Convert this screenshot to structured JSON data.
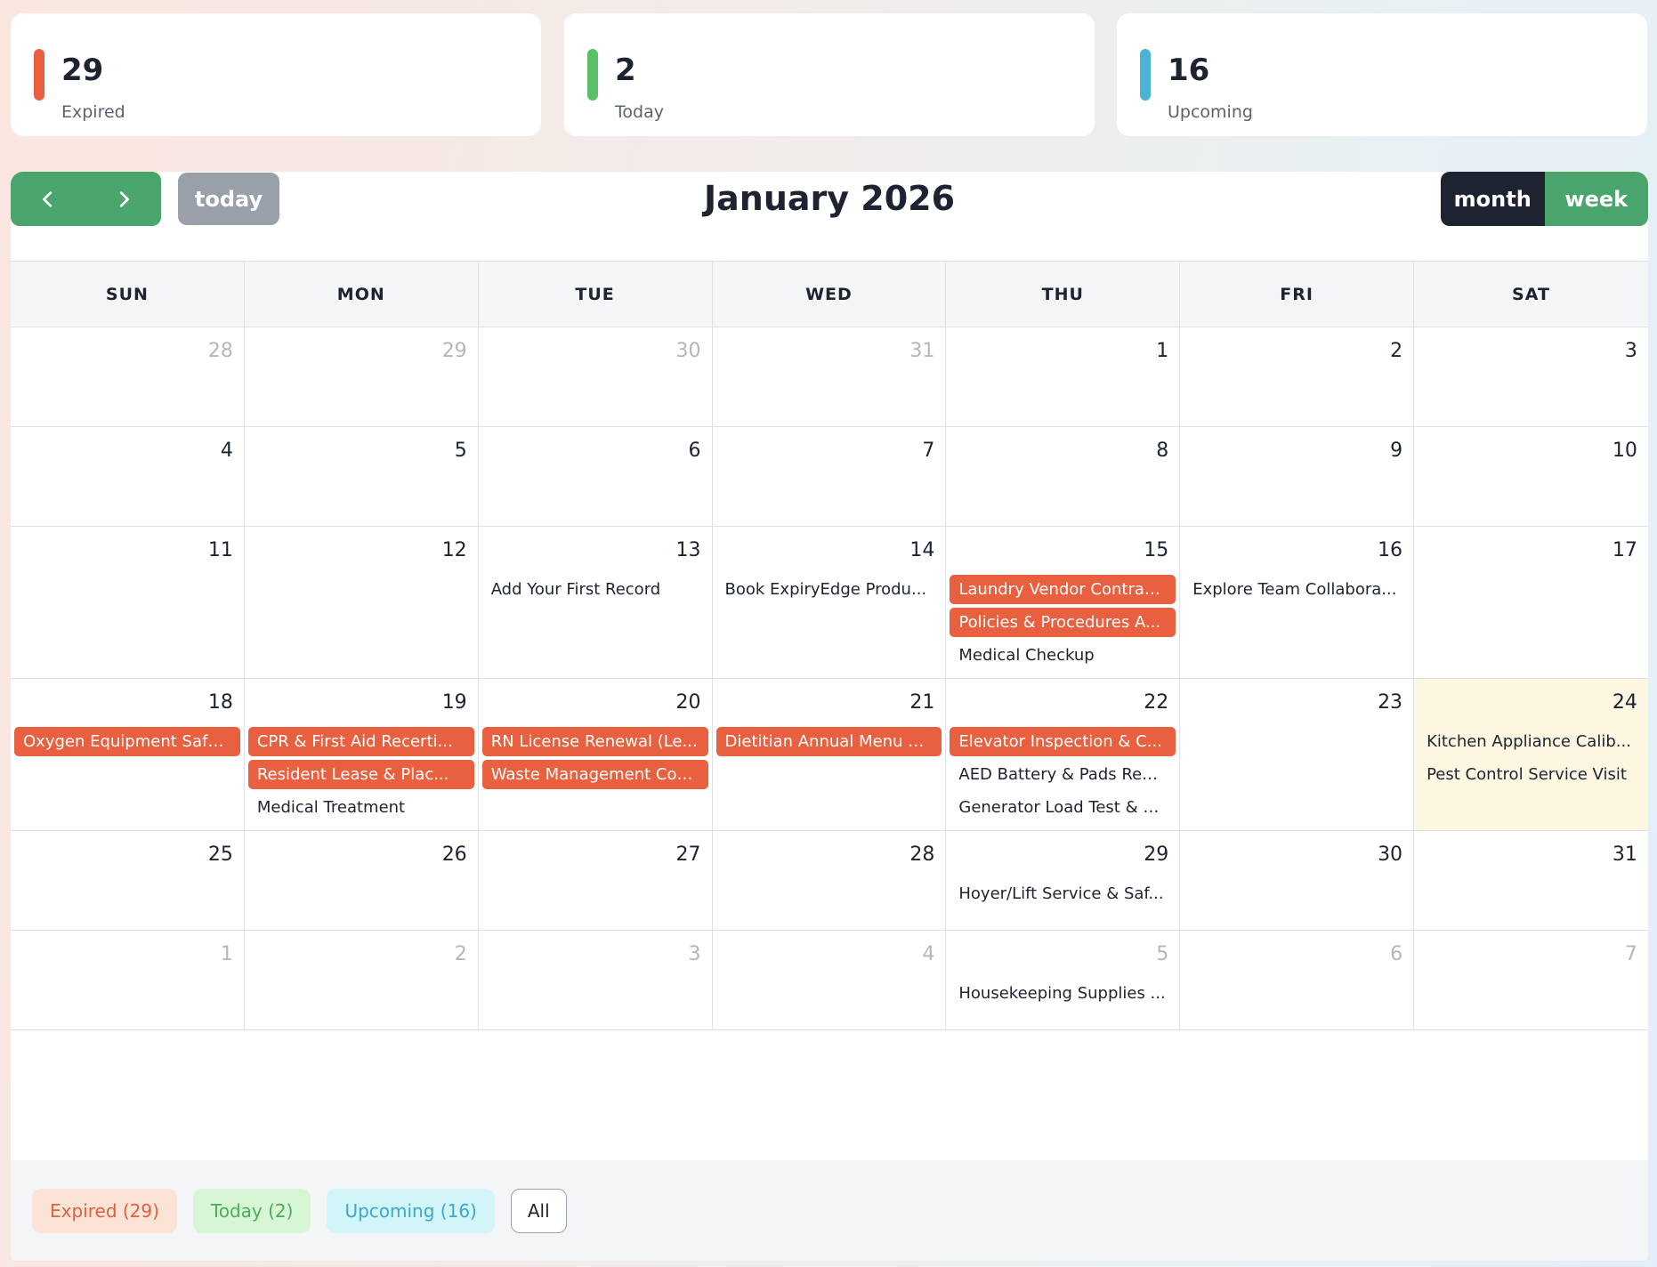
{
  "stats": [
    {
      "value": "29",
      "label": "Expired",
      "color": "#e8603f"
    },
    {
      "value": "2",
      "label": "Today",
      "color": "#59c068"
    },
    {
      "value": "16",
      "label": "Upcoming",
      "color": "#4bb3d6"
    }
  ],
  "toolbar": {
    "prev_icon": "chevron-left-icon",
    "next_icon": "chevron-right-icon",
    "today_label": "today",
    "title": "January 2026",
    "views": [
      {
        "label": "month",
        "active": true
      },
      {
        "label": "week",
        "active": false
      }
    ]
  },
  "weekdays": [
    "SUN",
    "MON",
    "TUE",
    "WED",
    "THU",
    "FRI",
    "SAT"
  ],
  "weeks": [
    {
      "height": 112,
      "days": [
        {
          "day": "28",
          "other": true,
          "events": []
        },
        {
          "day": "29",
          "other": true,
          "events": []
        },
        {
          "day": "30",
          "other": true,
          "events": []
        },
        {
          "day": "31",
          "other": true,
          "events": []
        },
        {
          "day": "1",
          "events": []
        },
        {
          "day": "2",
          "events": []
        },
        {
          "day": "3",
          "events": []
        }
      ]
    },
    {
      "height": 112,
      "days": [
        {
          "day": "4",
          "events": []
        },
        {
          "day": "5",
          "events": []
        },
        {
          "day": "6",
          "events": []
        },
        {
          "day": "7",
          "events": []
        },
        {
          "day": "8",
          "events": []
        },
        {
          "day": "9",
          "events": []
        },
        {
          "day": "10",
          "events": []
        }
      ]
    },
    {
      "height": 171,
      "days": [
        {
          "day": "11",
          "events": []
        },
        {
          "day": "12",
          "events": []
        },
        {
          "day": "13",
          "events": [
            {
              "title": "Add Your First Record",
              "status": "plain"
            }
          ]
        },
        {
          "day": "14",
          "events": [
            {
              "title": "Book ExpiryEdge Produ...",
              "status": "plain"
            }
          ]
        },
        {
          "day": "15",
          "events": [
            {
              "title": "Laundry Vendor Contrac...",
              "status": "expired"
            },
            {
              "title": "Policies & Procedures A...",
              "status": "expired"
            },
            {
              "title": "Medical Checkup",
              "status": "plain"
            }
          ]
        },
        {
          "day": "16",
          "events": [
            {
              "title": "Explore Team Collabora...",
              "status": "plain"
            }
          ]
        },
        {
          "day": "17",
          "events": []
        }
      ]
    },
    {
      "height": 171,
      "days": [
        {
          "day": "18",
          "events": [
            {
              "title": "Oxygen Equipment Safe...",
              "status": "expired"
            }
          ]
        },
        {
          "day": "19",
          "events": [
            {
              "title": "CPR & First Aid Recerti...",
              "status": "expired"
            },
            {
              "title": "Resident Lease &    Plac...",
              "status": "expired"
            },
            {
              "title": "Medical Treatment",
              "status": "plain"
            }
          ]
        },
        {
          "day": "20",
          "events": [
            {
              "title": "RN License Renewal (Le...",
              "status": "expired"
            },
            {
              "title": "Waste Management Con...",
              "status": "expired"
            }
          ]
        },
        {
          "day": "21",
          "events": [
            {
              "title": "Dietitian Annual Menu R...",
              "status": "expired"
            }
          ]
        },
        {
          "day": "22",
          "events": [
            {
              "title": "Elevator Inspection & C...",
              "status": "expired"
            },
            {
              "title": "AED Battery & Pads Rep...",
              "status": "plain"
            },
            {
              "title": "Generator Load Test & S...",
              "status": "plain"
            }
          ]
        },
        {
          "day": "23",
          "events": []
        },
        {
          "day": "24",
          "highlight": true,
          "events": [
            {
              "title": "Kitchen Appliance Calib...",
              "status": "plain"
            },
            {
              "title": "Pest Control Service Visit",
              "status": "plain"
            }
          ]
        }
      ]
    },
    {
      "height": 112,
      "days": [
        {
          "day": "25",
          "events": []
        },
        {
          "day": "26",
          "events": []
        },
        {
          "day": "27",
          "events": []
        },
        {
          "day": "28",
          "events": []
        },
        {
          "day": "29",
          "events": [
            {
              "title": "Hoyer/Lift Service & Saf...",
              "status": "plain"
            }
          ]
        },
        {
          "day": "30",
          "events": []
        },
        {
          "day": "31",
          "events": []
        }
      ]
    },
    {
      "height": 112,
      "days": [
        {
          "day": "1",
          "other": true,
          "events": []
        },
        {
          "day": "2",
          "other": true,
          "events": []
        },
        {
          "day": "3",
          "other": true,
          "events": []
        },
        {
          "day": "4",
          "other": true,
          "events": []
        },
        {
          "day": "5",
          "other": true,
          "events": [
            {
              "title": "Housekeeping Supplies ...",
              "status": "plain"
            }
          ]
        },
        {
          "day": "6",
          "other": true,
          "events": []
        },
        {
          "day": "7",
          "other": true,
          "events": []
        }
      ]
    }
  ],
  "legend": [
    {
      "label": "Expired (29)",
      "kind": "expired"
    },
    {
      "label": "Today (2)",
      "kind": "today"
    },
    {
      "label": "Upcoming (16)",
      "kind": "upcoming"
    },
    {
      "label": "All",
      "kind": "all"
    }
  ]
}
